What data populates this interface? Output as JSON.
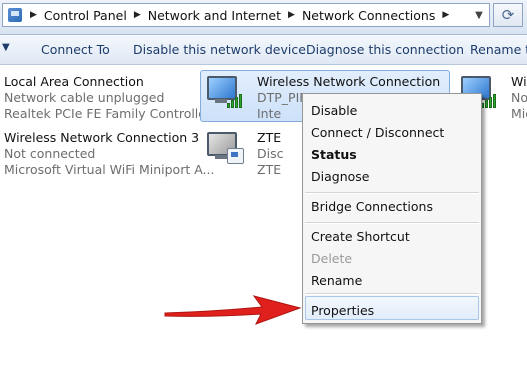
{
  "address_bar": {
    "breadcrumbs": [
      "Control Panel",
      "Network and Internet",
      "Network Connections"
    ]
  },
  "toolbar": {
    "commands": [
      "Connect To",
      "Disable this network device",
      "Diagnose this connection",
      "Rename th"
    ]
  },
  "connections": [
    {
      "name": "Local Area Connection",
      "status": "Network cable unplugged",
      "adapter": "Realtek PCIe FE Family Controller"
    },
    {
      "name": "Wireless Network Connection 3",
      "status": "Not connected",
      "adapter": "Microsoft Virtual WiFi Miniport A..."
    },
    {
      "name": "Wireless Network Connection",
      "status": "DTP_PIFAS",
      "adapter": "Inte"
    },
    {
      "name": "ZTE",
      "status": "Disc",
      "adapter": "ZTE"
    },
    {
      "name": "Wi",
      "status": "No",
      "adapter": "Mic"
    }
  ],
  "context_menu": {
    "items": [
      "Disable",
      "Connect / Disconnect",
      "Status",
      "Diagnose",
      "Bridge Connections",
      "Create Shortcut",
      "Delete",
      "Rename",
      "Properties"
    ]
  },
  "colors": {
    "accent": "#1e3d6b",
    "selection": "#cde1fa",
    "signal_green": "#2da62d",
    "arrow_red": "#e0201c"
  }
}
